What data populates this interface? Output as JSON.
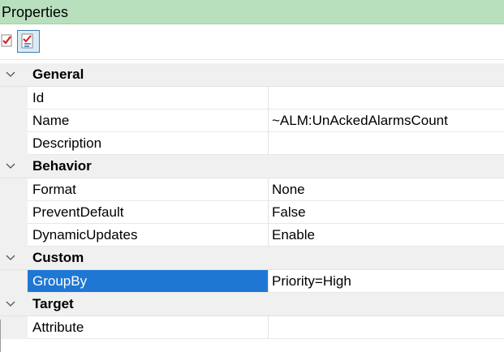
{
  "panel": {
    "title": "Properties"
  },
  "toolbar": {
    "buttons": [
      {
        "icon": "categorized-icon"
      },
      {
        "icon": "alphabetical-icon",
        "active": true
      }
    ]
  },
  "colors": {
    "title_bg": "#b8e0bd",
    "category_bg": "#f0f0f0",
    "selection_bg": "#1e77d3"
  },
  "categories": [
    {
      "label": "General",
      "properties": [
        {
          "name": "Id",
          "value": ""
        },
        {
          "name": "Name",
          "value": "~ALM:UnAckedAlarmsCount"
        },
        {
          "name": "Description",
          "value": ""
        }
      ]
    },
    {
      "label": "Behavior",
      "properties": [
        {
          "name": "Format",
          "value": "None"
        },
        {
          "name": "PreventDefault",
          "value": "False"
        },
        {
          "name": "DynamicUpdates",
          "value": "Enable"
        }
      ]
    },
    {
      "label": "Custom",
      "properties": [
        {
          "name": "GroupBy",
          "value": "Priority=High",
          "selected": true
        }
      ]
    },
    {
      "label": "Target",
      "properties": [
        {
          "name": "Attribute",
          "value": ""
        }
      ]
    }
  ]
}
